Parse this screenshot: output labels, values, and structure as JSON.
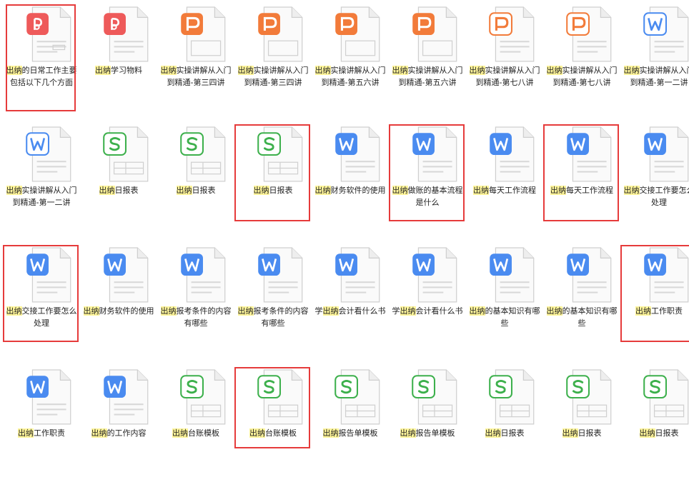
{
  "colors": {
    "pdf": "#ee5a5a",
    "ppt": "#f27b3a",
    "ppt_outline": "#f27b3a",
    "word": "#4a8bf0",
    "excel": "#3db04c",
    "highlight": "#fff59a",
    "selection_box": "#e63b3b"
  },
  "files": [
    {
      "type": "pdf-filled",
      "icon": "pdf-icon",
      "hl": "出纳",
      "rest": "的日常工作主要包括以下几个方面",
      "boxed": true
    },
    {
      "type": "pdf-plain",
      "icon": "pdf-icon",
      "hl": "出纳",
      "rest": "学习物料",
      "boxed": false
    },
    {
      "type": "ppt",
      "icon": "presentation-icon",
      "hl": "出纳",
      "rest": "实操讲解从入门到精通-第三四讲",
      "boxed": false
    },
    {
      "type": "ppt",
      "icon": "presentation-icon",
      "hl": "出纳",
      "rest": "实操讲解从入门到精通-第三四讲",
      "boxed": false
    },
    {
      "type": "ppt",
      "icon": "presentation-icon",
      "hl": "出纳",
      "rest": "实操讲解从入门到精通-第五六讲",
      "boxed": false
    },
    {
      "type": "ppt",
      "icon": "presentation-icon",
      "hl": "出纳",
      "rest": "实操讲解从入门到精通-第五六讲",
      "boxed": false
    },
    {
      "type": "ppt-outline",
      "icon": "presentation-icon",
      "hl": "出纳",
      "rest": "实操讲解从入门到精通-第七八讲",
      "boxed": false
    },
    {
      "type": "ppt-outline",
      "icon": "presentation-icon",
      "hl": "出纳",
      "rest": "实操讲解从入门到精通-第七八讲",
      "boxed": false
    },
    {
      "type": "word-outline",
      "icon": "word-document-icon",
      "hl": "出纳",
      "rest": "实操讲解从入门到精通-第一二讲",
      "boxed": false
    },
    {
      "type": "word-outline",
      "icon": "word-document-icon",
      "hl": "出纳",
      "rest": "实操讲解从入门到精通-第一二讲",
      "boxed": false
    },
    {
      "type": "excel-outline",
      "icon": "spreadsheet-icon",
      "hl": "出纳",
      "rest": "日报表",
      "boxed": false
    },
    {
      "type": "excel-outline",
      "icon": "spreadsheet-icon",
      "hl": "出纳",
      "rest": "日报表",
      "boxed": false
    },
    {
      "type": "excel-outline",
      "icon": "spreadsheet-icon",
      "hl": "出纳",
      "rest": "日报表",
      "boxed": true
    },
    {
      "type": "word",
      "icon": "word-document-icon",
      "hl": "出纳",
      "rest": "财务软件的使用",
      "boxed": false
    },
    {
      "type": "word",
      "icon": "word-document-icon",
      "hl": "出纳",
      "rest": "做账的基本流程是什么",
      "boxed": true
    },
    {
      "type": "word",
      "icon": "word-document-icon",
      "hl": "出纳",
      "rest": "每天工作流程",
      "boxed": false
    },
    {
      "type": "word",
      "icon": "word-document-icon",
      "hl": "出纳",
      "rest": "每天工作流程",
      "boxed": true
    },
    {
      "type": "word",
      "icon": "word-document-icon",
      "hl": "出纳",
      "rest": "交接工作要怎么处理",
      "boxed": false
    },
    {
      "type": "word",
      "icon": "word-document-icon",
      "hl": "出纳",
      "rest": "交接工作要怎么处理",
      "boxed": true
    },
    {
      "type": "word",
      "icon": "word-document-icon",
      "hl": "出纳",
      "rest": "财务软件的使用",
      "boxed": false
    },
    {
      "type": "word",
      "icon": "word-document-icon",
      "hl": "出纳",
      "rest": "报考条件的内容有哪些",
      "boxed": false
    },
    {
      "type": "word",
      "icon": "word-document-icon",
      "hl": "出纳",
      "rest": "报考条件的内容有哪些",
      "boxed": false
    },
    {
      "type": "word",
      "icon": "word-document-icon",
      "pre": "学",
      "hl": "出纳",
      "rest": "会计看什么书",
      "boxed": false
    },
    {
      "type": "word",
      "icon": "word-document-icon",
      "pre": "学",
      "hl": "出纳",
      "rest": "会计看什么书",
      "boxed": false
    },
    {
      "type": "word",
      "icon": "word-document-icon",
      "hl": "出纳",
      "rest": "的基本知识有哪些",
      "boxed": false
    },
    {
      "type": "word",
      "icon": "word-document-icon",
      "hl": "出纳",
      "rest": "的基本知识有哪些",
      "boxed": false
    },
    {
      "type": "word",
      "icon": "word-document-icon",
      "hl": "出纳",
      "rest": "工作职责",
      "boxed": true
    },
    {
      "type": "word",
      "icon": "word-document-icon",
      "hl": "出纳",
      "rest": "工作职责",
      "boxed": false
    },
    {
      "type": "word",
      "icon": "word-document-icon",
      "hl": "出纳",
      "rest": "的工作内容",
      "boxed": false
    },
    {
      "type": "excel-outline",
      "icon": "spreadsheet-icon",
      "hl": "出纳",
      "rest": "台账模板",
      "boxed": false
    },
    {
      "type": "excel-outline",
      "icon": "spreadsheet-icon",
      "hl": "出纳",
      "rest": "台账模板",
      "boxed": true
    },
    {
      "type": "excel-outline",
      "icon": "spreadsheet-icon",
      "hl": "出纳",
      "rest": "报告单模板",
      "boxed": false
    },
    {
      "type": "excel-outline",
      "icon": "spreadsheet-icon",
      "hl": "出纳",
      "rest": "报告单模板",
      "boxed": false
    },
    {
      "type": "excel-outline",
      "icon": "spreadsheet-icon",
      "hl": "出纳",
      "rest": "日报表",
      "boxed": false
    },
    {
      "type": "excel-outline",
      "icon": "spreadsheet-icon",
      "hl": "出纳",
      "rest": "日报表",
      "boxed": false
    },
    {
      "type": "excel-outline",
      "icon": "spreadsheet-icon",
      "hl": "出纳",
      "rest": "日报表",
      "boxed": false
    }
  ]
}
